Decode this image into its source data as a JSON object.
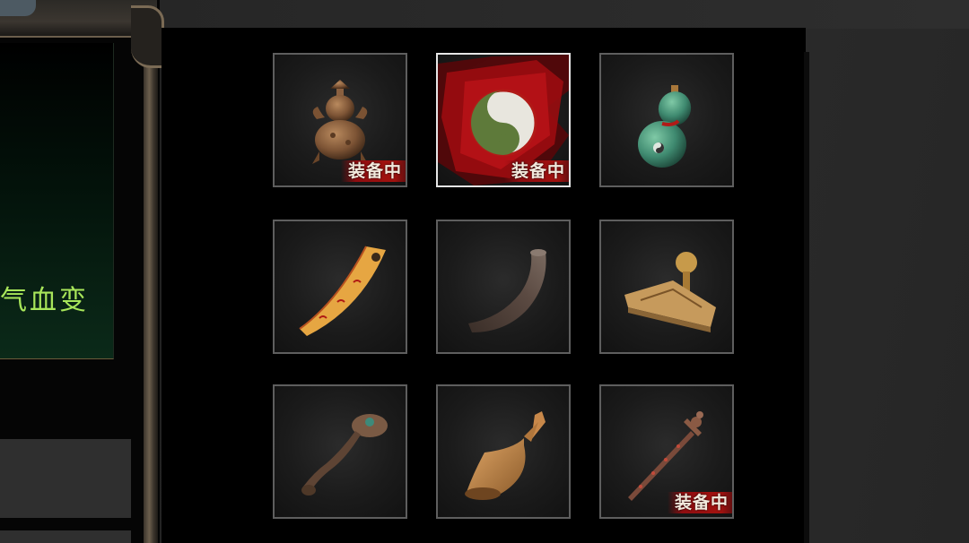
{
  "left_panel": {
    "partial_text": "气血变"
  },
  "inventory": {
    "slots": [
      {
        "item": "gourd-pagoda-icon",
        "equipped": true,
        "badge": "装备中"
      },
      {
        "item": "yin-yang-icon",
        "equipped": true,
        "badge": "装备中",
        "selected": true
      },
      {
        "item": "jade-gourd-icon",
        "equipped": false,
        "badge": ""
      },
      {
        "item": "talisman-scroll-icon",
        "equipped": false,
        "badge": ""
      },
      {
        "item": "horn-icon",
        "equipped": false,
        "badge": ""
      },
      {
        "item": "seal-stamp-icon",
        "equipped": false,
        "badge": ""
      },
      {
        "item": "ruyi-scepter-icon",
        "equipped": false,
        "badge": ""
      },
      {
        "item": "bell-icon",
        "equipped": false,
        "badge": ""
      },
      {
        "item": "coin-sword-icon",
        "equipped": true,
        "badge": "装备中"
      }
    ]
  },
  "colors": {
    "badge_red": "#a3120f",
    "green_text": "#a8e65a",
    "selected_border": "#e6e6e6",
    "slot_border": "#5e5e5e"
  }
}
